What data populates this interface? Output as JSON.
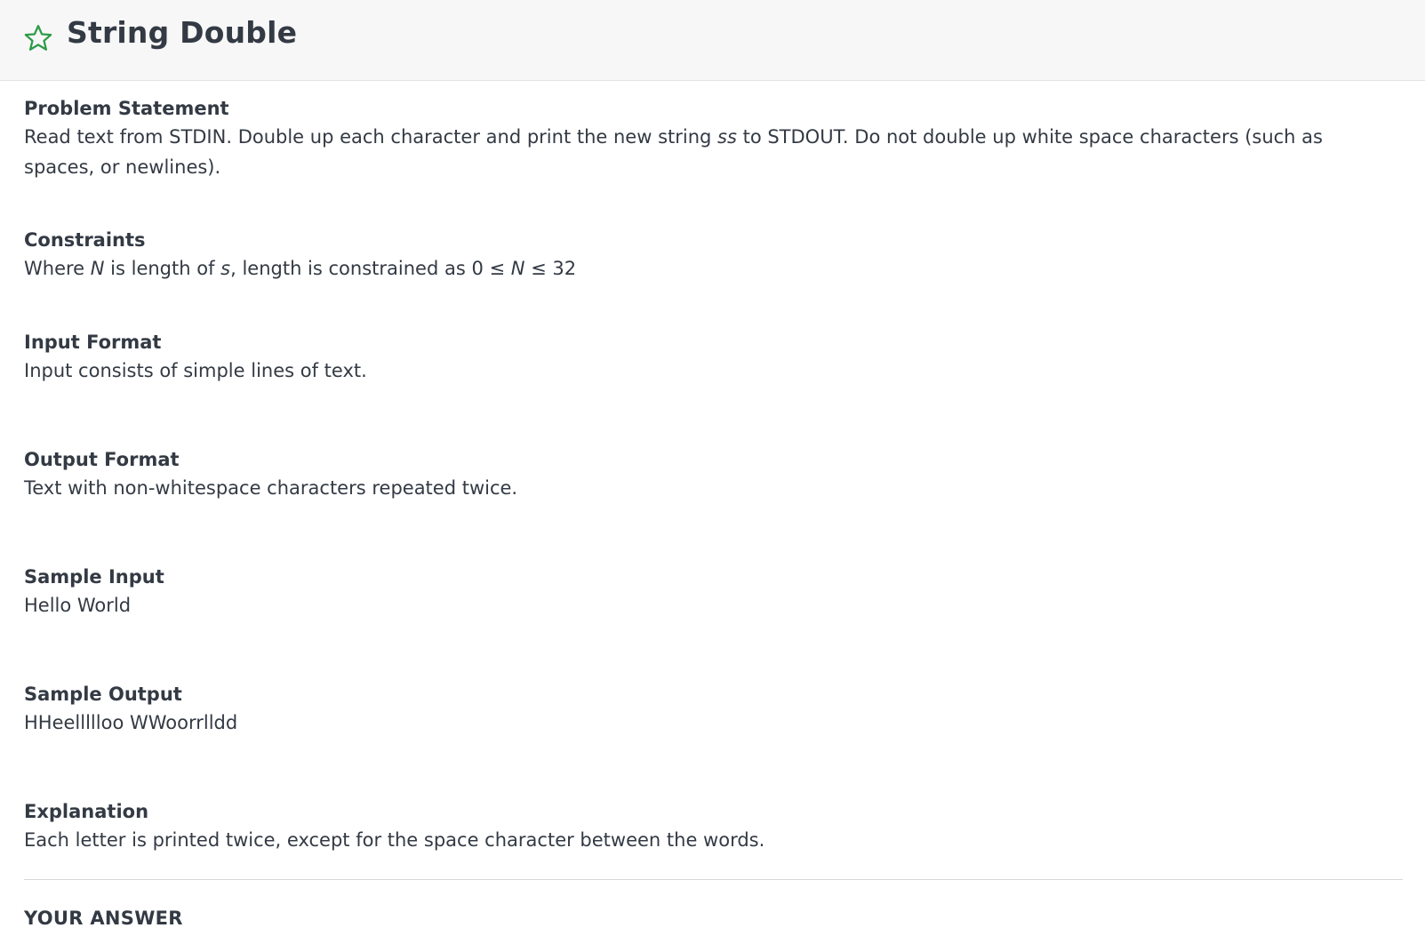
{
  "header": {
    "star_icon": "star-outline-icon",
    "star_color": "#2e9b47",
    "title": "String Double"
  },
  "problem_statement": {
    "heading": "Problem Statement",
    "text_before": "Read text from STDIN. Double up each character and print the new string ",
    "var": "ss",
    "text_after": " to STDOUT. Do not double up white space characters (such as spaces, or newlines)."
  },
  "constraints": {
    "heading": "Constraints",
    "t1": "Where ",
    "v1": "N",
    "t2": " is length of ",
    "v2": "s",
    "t3": ", length is constrained as 0 ≤ ",
    "v3": "N",
    "t4": " ≤ 32"
  },
  "input_format": {
    "heading": "Input Format",
    "text": "Input consists of simple lines of text."
  },
  "output_format": {
    "heading": "Output Format",
    "text": "Text with non-whitespace characters repeated twice."
  },
  "sample_input": {
    "heading": "Sample Input",
    "text": "Hello World"
  },
  "sample_output": {
    "heading": "Sample Output",
    "text": "HHeellllloo WWoorrlldd"
  },
  "explanation": {
    "heading": "Explanation",
    "text": "Each letter is printed twice, except for the space character between the words."
  },
  "answer": {
    "heading": "YOUR ANSWER"
  }
}
